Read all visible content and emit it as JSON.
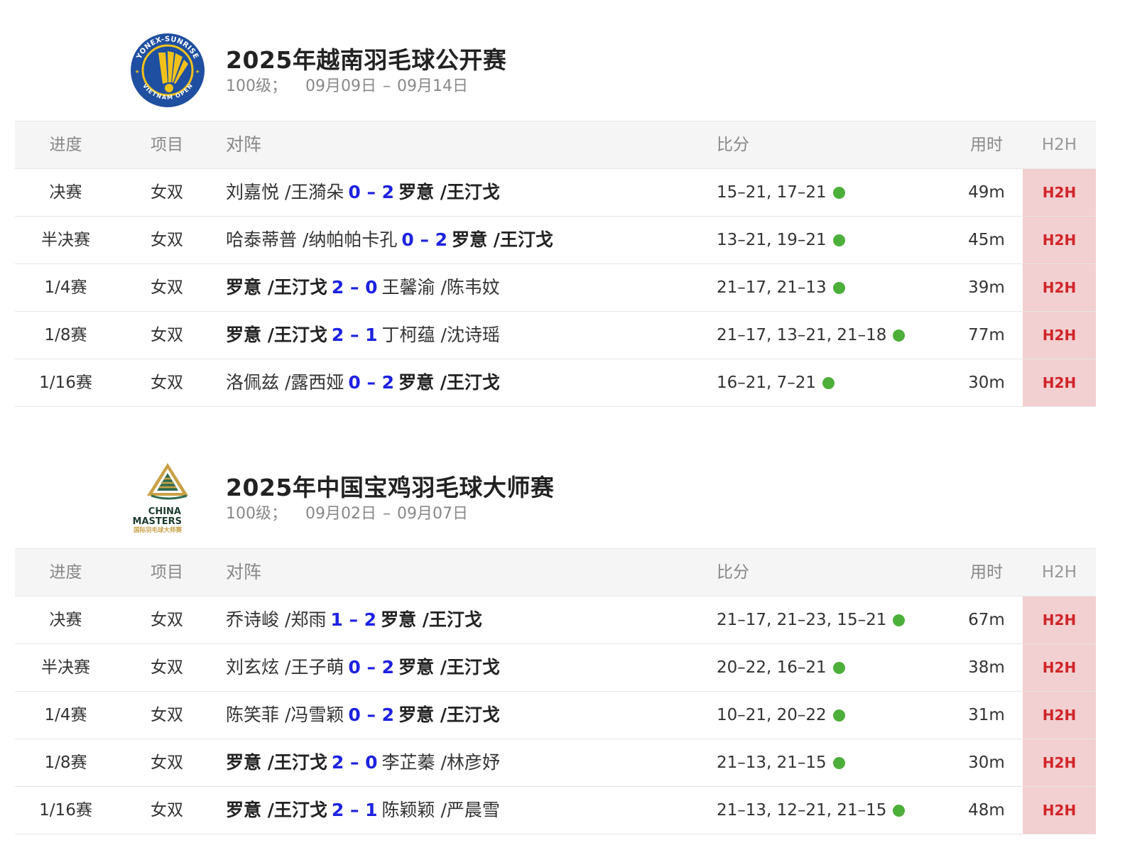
{
  "colors": {
    "score_blue": "#1d22e0",
    "h2h_bg": "#f2cfd0",
    "h2h_text": "#d0252a",
    "dot_green": "#4caf3a"
  },
  "tournaments": [
    {
      "title": "2025年越南羽毛球公开赛",
      "level": "100级；",
      "date_start": "09月09日",
      "date_sep": "–",
      "date_end": "09月14日",
      "logo": {
        "name": "vietnam-open-logo",
        "text_top": "YONEX-SUNRISE",
        "text_bottom": "VIETNAM OPEN"
      },
      "headers": {
        "stage": "进度",
        "event": "项目",
        "match": "对阵",
        "score": "比分",
        "duration": "用时",
        "h2h": "H2H"
      },
      "matches": [
        {
          "stage": "决赛",
          "event": "女双",
          "left": "刘嘉悦 /王漪朵",
          "left_win": false,
          "ms": "0 – 2",
          "right": "罗意 /王汀戈",
          "right_win": true,
          "score": "15–21, 17–21",
          "duration": "49m",
          "h2h": "H2H"
        },
        {
          "stage": "半决赛",
          "event": "女双",
          "left": "哈泰蒂普 /纳帕帕卡孔",
          "left_win": false,
          "ms": "0 – 2",
          "right": "罗意 /王汀戈",
          "right_win": true,
          "score": "13–21, 19–21",
          "duration": "45m",
          "h2h": "H2H"
        },
        {
          "stage": "1/4赛",
          "event": "女双",
          "left": "罗意 /王汀戈",
          "left_win": true,
          "ms": "2 – 0",
          "right": "王馨渝 /陈韦妏",
          "right_win": false,
          "score": "21–17, 21–13",
          "duration": "39m",
          "h2h": "H2H"
        },
        {
          "stage": "1/8赛",
          "event": "女双",
          "left": "罗意 /王汀戈",
          "left_win": true,
          "ms": "2 – 1",
          "right": "丁柯蕴 /沈诗瑶",
          "right_win": false,
          "score": "21–17, 13–21, 21–18",
          "duration": "77m",
          "h2h": "H2H"
        },
        {
          "stage": "1/16赛",
          "event": "女双",
          "left": "洛佩兹 /露西娅",
          "left_win": false,
          "ms": "0 – 2",
          "right": "罗意 /王汀戈",
          "right_win": true,
          "score": "16–21, 7–21",
          "duration": "30m",
          "h2h": "H2H"
        }
      ]
    },
    {
      "title": "2025年中国宝鸡羽毛球大师赛",
      "level": "100级；",
      "date_start": "09月02日",
      "date_sep": "–",
      "date_end": "09月07日",
      "logo": {
        "name": "china-masters-logo",
        "text_line1": "CHINA",
        "text_line2": "MASTERS",
        "text_line3": "国际羽毛球大师赛"
      },
      "headers": {
        "stage": "进度",
        "event": "项目",
        "match": "对阵",
        "score": "比分",
        "duration": "用时",
        "h2h": "H2H"
      },
      "matches": [
        {
          "stage": "决赛",
          "event": "女双",
          "left": "乔诗峻 /郑雨",
          "left_win": false,
          "ms": "1 – 2",
          "right": "罗意 /王汀戈",
          "right_win": true,
          "score": "21–17, 21–23, 15–21",
          "duration": "67m",
          "h2h": "H2H"
        },
        {
          "stage": "半决赛",
          "event": "女双",
          "left": "刘玄炫 /王子萌",
          "left_win": false,
          "ms": "0 – 2",
          "right": "罗意 /王汀戈",
          "right_win": true,
          "score": "20–22, 16–21",
          "duration": "38m",
          "h2h": "H2H"
        },
        {
          "stage": "1/4赛",
          "event": "女双",
          "left": "陈笑菲 /冯雪颖",
          "left_win": false,
          "ms": "0 – 2",
          "right": "罗意 /王汀戈",
          "right_win": true,
          "score": "10–21, 20–22",
          "duration": "31m",
          "h2h": "H2H"
        },
        {
          "stage": "1/8赛",
          "event": "女双",
          "left": "罗意 /王汀戈",
          "left_win": true,
          "ms": "2 – 0",
          "right": "李芷蓁 /林彦妤",
          "right_win": false,
          "score": "21–13, 21–15",
          "duration": "30m",
          "h2h": "H2H"
        },
        {
          "stage": "1/16赛",
          "event": "女双",
          "left": "罗意 /王汀戈",
          "left_win": true,
          "ms": "2 – 1",
          "right": "陈颖颖 /严晨雪",
          "right_win": false,
          "score": "21–13, 12–21, 21–15",
          "duration": "48m",
          "h2h": "H2H"
        }
      ]
    }
  ]
}
